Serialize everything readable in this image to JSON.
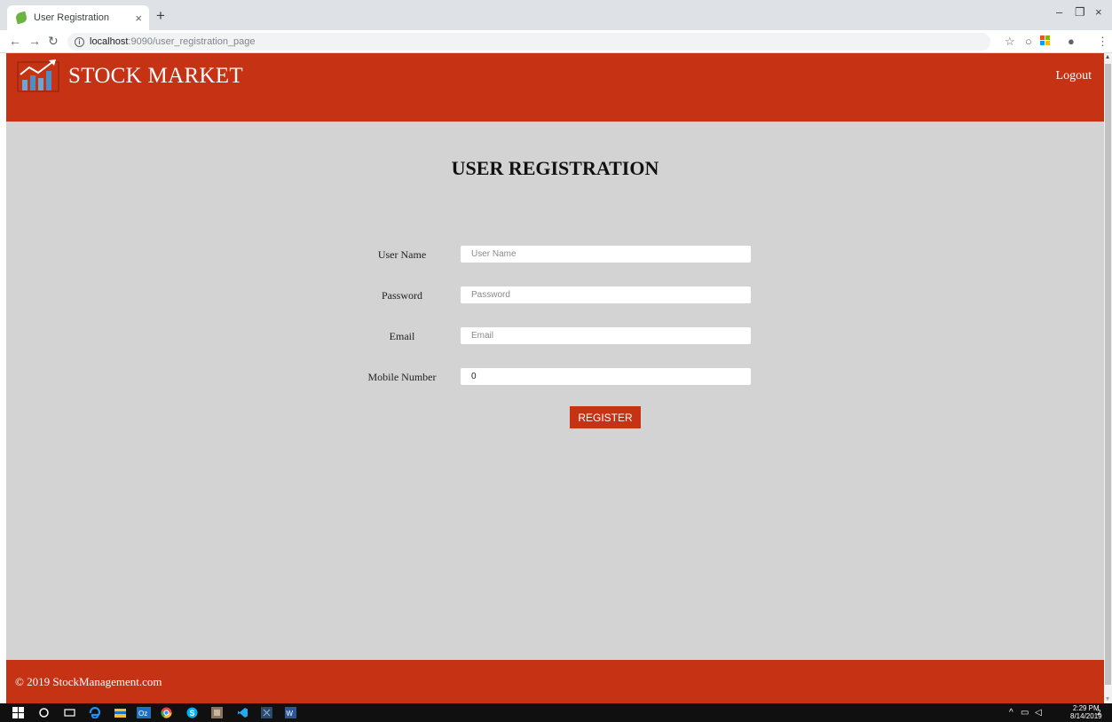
{
  "browser": {
    "tab_title": "User Registration",
    "tab_close": "×",
    "new_tab": "+",
    "url_host": "localhost",
    "url_path": ":9090/user_registration_page",
    "window_controls": {
      "minimize": "–",
      "restore": "❐",
      "close": "×"
    }
  },
  "header": {
    "brand": "STOCK MARKET",
    "logout": "Logout",
    "color": "#c63214"
  },
  "main": {
    "title": "USER REGISTRATION",
    "fields": [
      {
        "label": "User Name",
        "placeholder": "User Name",
        "value": ""
      },
      {
        "label": "Password",
        "placeholder": "Password",
        "value": ""
      },
      {
        "label": "Email",
        "placeholder": "Email",
        "value": ""
      },
      {
        "label": "Mobile Number",
        "placeholder": "",
        "value": "0"
      }
    ],
    "register_label": "REGISTER",
    "background": "#d3d3d3"
  },
  "footer": {
    "copyright": "© 2019 StockManagement.com"
  },
  "taskbar": {
    "time": "2:29 PM",
    "date": "8/14/2019",
    "notification_count": "2"
  }
}
